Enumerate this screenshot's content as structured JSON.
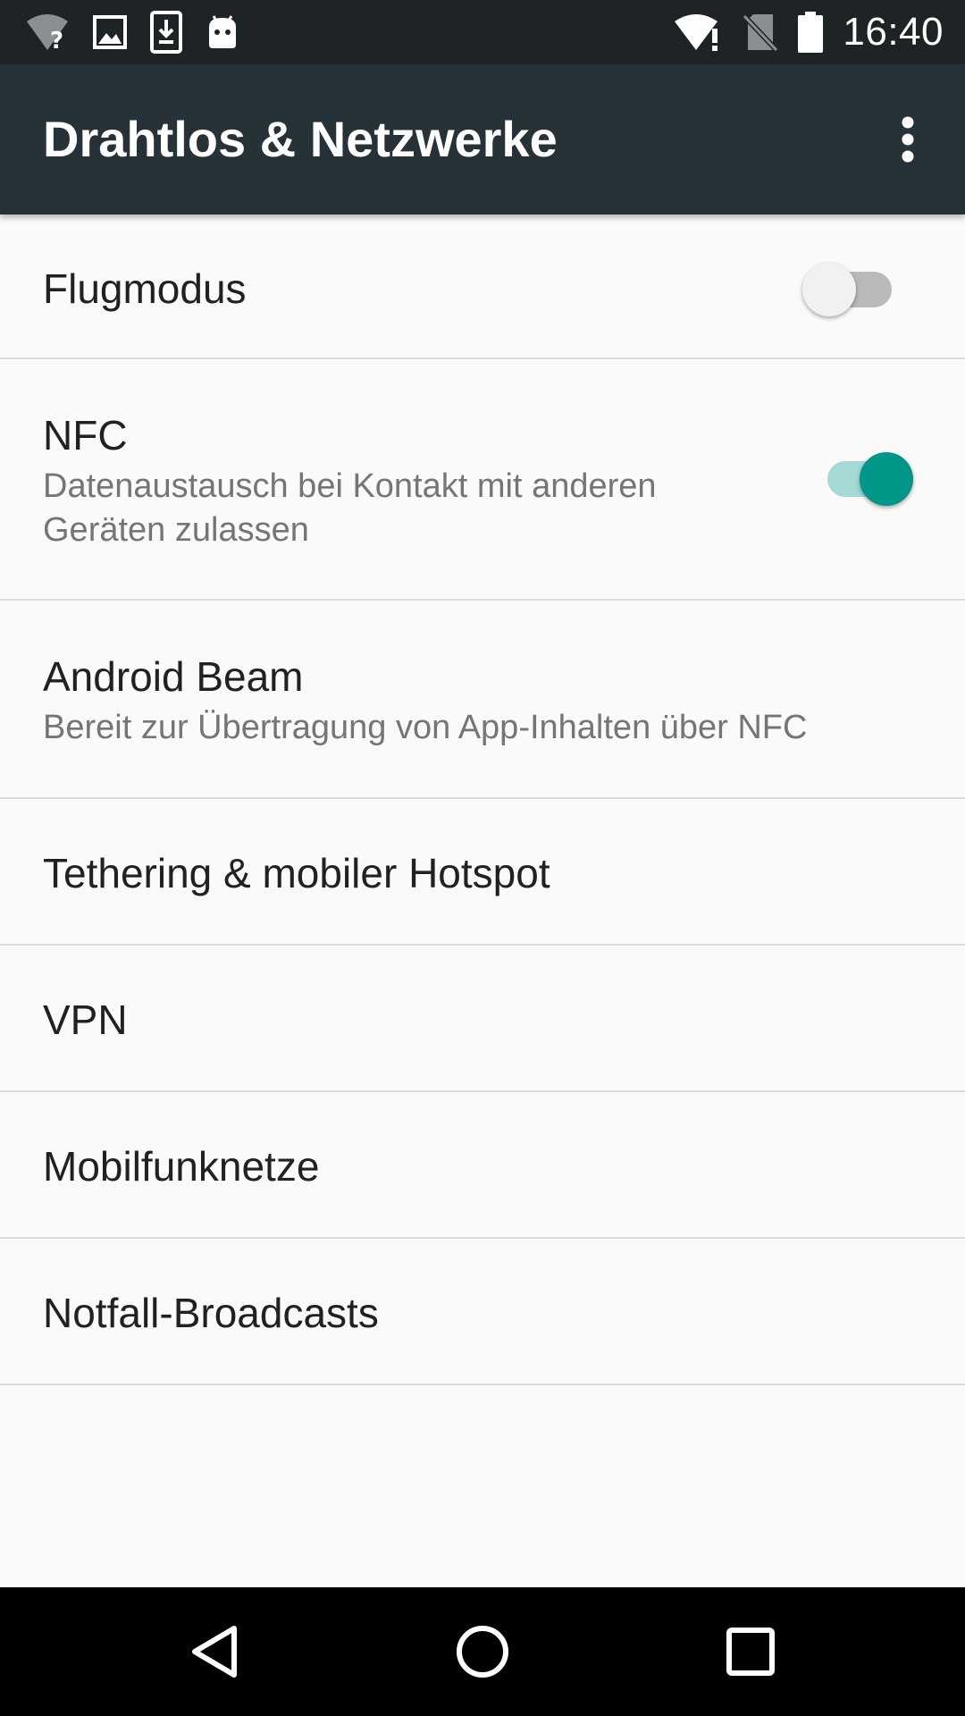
{
  "status_bar": {
    "time": "16:40",
    "left_icons": [
      "wifi-unknown-icon",
      "image-icon",
      "download-icon",
      "android-icon"
    ],
    "right_icons": [
      "wifi-alert-icon",
      "no-sim-icon",
      "battery-icon"
    ]
  },
  "app_bar": {
    "title": "Drahtlos & Netzwerke",
    "overflow_icon": "more-vert-icon"
  },
  "settings": {
    "flugmodus": {
      "title": "Flugmodus",
      "enabled": false
    },
    "nfc": {
      "title": "NFC",
      "summary": "Datenaustausch bei Kontakt mit anderen Geräten zulassen",
      "enabled": true
    },
    "android_beam": {
      "title": "Android Beam",
      "summary": "Bereit zur Übertragung von App-Inhalten über NFC"
    },
    "tethering": {
      "title": "Tethering & mobiler Hotspot"
    },
    "vpn": {
      "title": "VPN"
    },
    "mobilfunknetze": {
      "title": "Mobilfunknetze"
    },
    "notfall": {
      "title": "Notfall-Broadcasts"
    }
  },
  "colors": {
    "status_bar": "#1e2326",
    "app_bar": "#263238",
    "accent": "#009688",
    "background": "#fafafa"
  },
  "nav_bar": {
    "buttons": [
      "back-icon",
      "home-icon",
      "recents-icon"
    ]
  }
}
